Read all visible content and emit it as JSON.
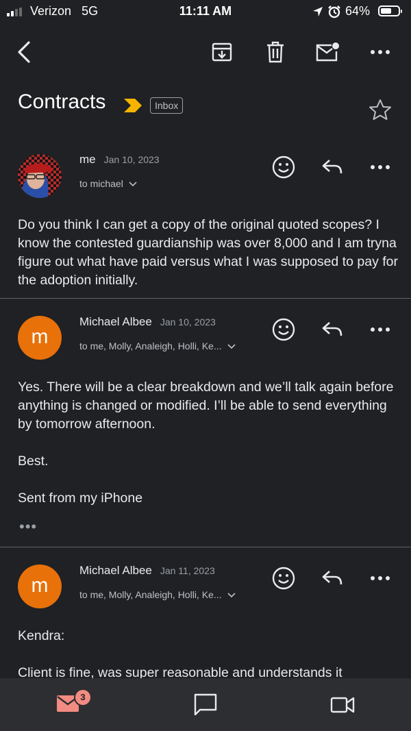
{
  "status_bar": {
    "carrier": "Verizon",
    "network": "5G",
    "time": "11:11 AM",
    "battery": "64%",
    "battery_level": 0.64,
    "signal_bars": 2
  },
  "toolbar": {
    "icons": [
      "back-arrow-icon",
      "archive-icon",
      "trash-icon",
      "mark-unread-icon",
      "more-icon"
    ]
  },
  "thread": {
    "subject": "Contracts",
    "label": "Inbox",
    "starred": false
  },
  "messages": [
    {
      "sender": "me",
      "date": "Jan 10, 2023",
      "recipients": "to michael",
      "body": "Do you think I can get a copy of the original quoted scopes? I know the contested guardianship was over 8,000 and I am tryna figure out what have paid versus what I was supposed to pay for the adoption initially."
    },
    {
      "sender": "Michael Albee",
      "avatar_letter": "m",
      "date": "Jan 10, 2023",
      "recipients": "to me, Molly, Analeigh, Holli, Ke...",
      "body": "Yes. There will be a clear breakdown and we’ll talk again before anything is changed or modified. I’ll be able to send everything by tomorrow afternoon.\n\nBest.\n\nSent from my iPhone",
      "quoted_toggle": "•••"
    },
    {
      "sender": "Michael Albee",
      "avatar_letter": "m",
      "date": "Jan 11, 2023",
      "recipients": "to me, Molly, Analeigh, Holli, Ke...",
      "body": "Kendra:\n\nClient is fine, was super reasonable and understands it"
    }
  ],
  "bottom_nav": {
    "mail_badge": "3",
    "items": [
      "mail-icon",
      "chat-icon",
      "meet-icon"
    ]
  },
  "colors": {
    "background": "#202124",
    "avatar_orange": "#e8710a",
    "label_yellow": "#f6b400",
    "badge": "#f28b82"
  }
}
